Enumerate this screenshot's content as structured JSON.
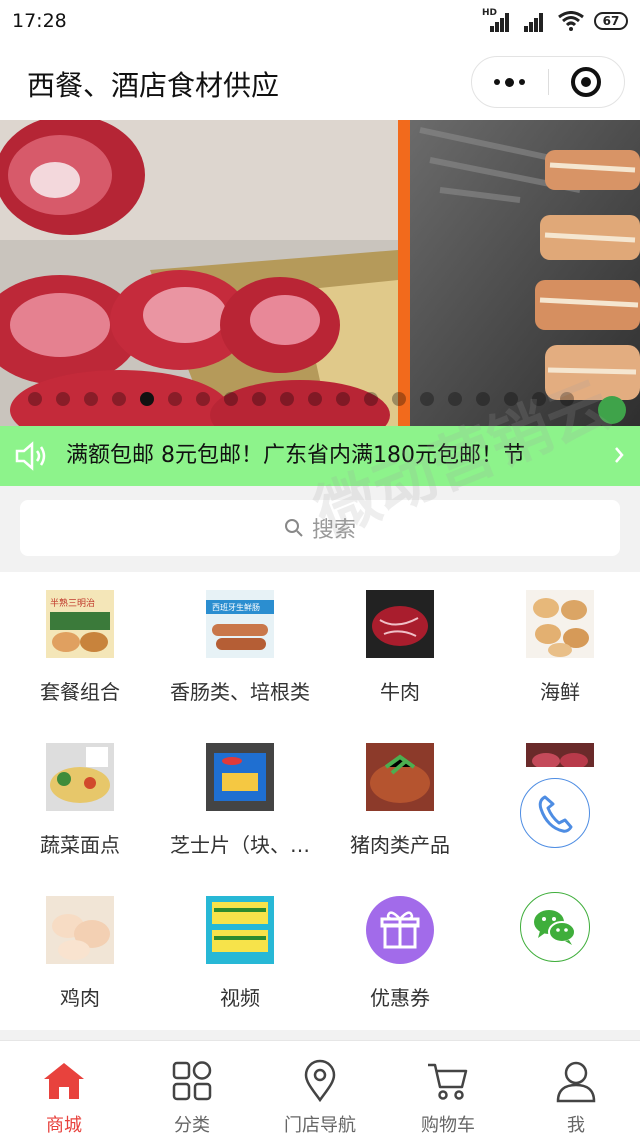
{
  "status_bar": {
    "time": "17:28",
    "battery": "67",
    "network_badge": "HD"
  },
  "nav": {
    "title": "西餐、酒店食材供应"
  },
  "banner": {
    "slide_count": 20,
    "active_index": 4
  },
  "notice": {
    "text": "满额包邮  8元包邮！广东省内满180元包邮！节"
  },
  "search": {
    "placeholder": "搜索"
  },
  "watermark": "微动营销云",
  "categories": [
    {
      "label": "套餐组合"
    },
    {
      "label": "香肠类、培根类"
    },
    {
      "label": "牛肉"
    },
    {
      "label": "海鲜"
    },
    {
      "label": "蔬菜面点"
    },
    {
      "label": "芝士片（块、…"
    },
    {
      "label": "猪肉类产品"
    },
    {
      "label": ""
    },
    {
      "label": "鸡肉"
    },
    {
      "label": "视频"
    },
    {
      "label": "优惠券"
    }
  ],
  "thumb_texts": {
    "sausage": "西班牙生鲜肠",
    "combo": "半熟三明治"
  },
  "tabs": [
    {
      "label": "商城",
      "active": true
    },
    {
      "label": "分类",
      "active": false
    },
    {
      "label": "门店导航",
      "active": false
    },
    {
      "label": "购物车",
      "active": false
    },
    {
      "label": "我",
      "active": false
    }
  ],
  "colors": {
    "accent": "#e8423d",
    "notice_bg": "#8df38b",
    "phone": "#4e8de3",
    "wechat": "#3fae3b",
    "coupon": "#a26bea"
  }
}
